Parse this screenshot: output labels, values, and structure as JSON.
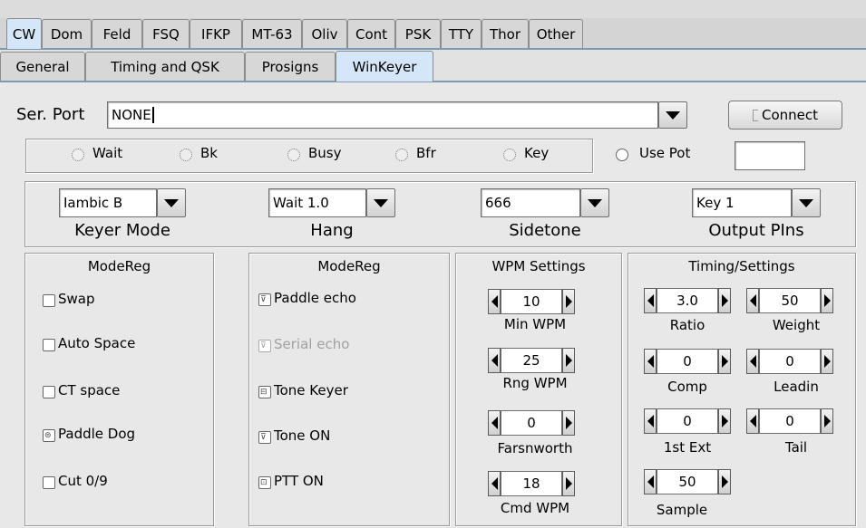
{
  "tabs_top": [
    "CW",
    "Dom",
    "Feld",
    "FSQ",
    "IFKP",
    "MT-63",
    "Oliv",
    "Cont",
    "PSK",
    "TTY",
    "Thor",
    "Other"
  ],
  "tabs_sub": [
    "General",
    "Timing and QSK",
    "Prosigns",
    "WinKeyer"
  ],
  "serport": {
    "label": "Ser. Port",
    "value": "NONE",
    "connect": "Connect"
  },
  "leds": [
    "Wait",
    "Bk",
    "Busy",
    "Bfr",
    "Key"
  ],
  "use_pot": {
    "label": "Use Pot",
    "value": ""
  },
  "keyer_mode": {
    "value": "Iambic B",
    "label": "Keyer Mode"
  },
  "hang": {
    "value": "Wait 1.0",
    "label": "Hang"
  },
  "sidetone": {
    "value": "666",
    "label": "Sidetone"
  },
  "output_pins": {
    "value": "Key 1",
    "label": "Output PIns"
  },
  "modereg1": {
    "title": "ModeReg",
    "items": [
      "Swap",
      "Auto Space",
      "CT space",
      "Paddle Dog",
      "Cut 0/9"
    ]
  },
  "modereg2": {
    "title": "ModeReg",
    "items": [
      "Paddle echo",
      "Serial echo",
      "Tone Keyer",
      "Tone ON",
      "PTT ON"
    ]
  },
  "wpm": {
    "title": "WPM Settings",
    "min_wpm": {
      "value": "10",
      "label": "Min WPM"
    },
    "rng_wpm": {
      "value": "25",
      "label": "Rng WPM"
    },
    "farnsworth": {
      "value": "0",
      "label": "Farsnworth"
    },
    "cmd_wpm": {
      "value": "18",
      "label": "Cmd WPM"
    }
  },
  "timing": {
    "title": "Timing/Settings",
    "ratio": {
      "value": "3.0",
      "label": "Ratio"
    },
    "weight": {
      "value": "50",
      "label": "Weight"
    },
    "comp": {
      "value": "0",
      "label": "Comp"
    },
    "leadin": {
      "value": "0",
      "label": "Leadin"
    },
    "first_ext": {
      "value": "0",
      "label": "1st Ext"
    },
    "tail": {
      "value": "0",
      "label": "Tail"
    },
    "sample": {
      "value": "50",
      "label": "Sample"
    }
  },
  "colors": {
    "active_tab": "#d4e6f7",
    "panel": "#e8e8e8",
    "frame": "#9a9a9a"
  }
}
